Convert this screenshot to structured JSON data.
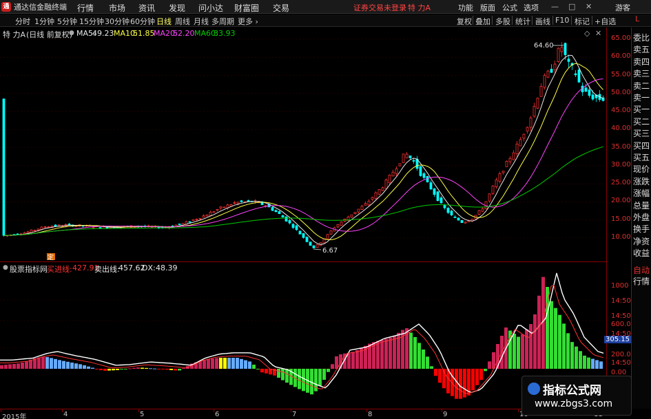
{
  "app": {
    "title": "通达信金融终端",
    "logo": "通"
  },
  "menu": {
    "items": [
      "行情",
      "市场",
      "资讯",
      "发现",
      "问小达",
      "财富圈",
      "交易"
    ],
    "login_status": "证券交易未登录",
    "stock_name": "特 力A",
    "right_items": [
      "功能",
      "版面",
      "公式",
      "选项"
    ],
    "guest": "游客",
    "window_buttons": [
      "—",
      "□",
      "✕"
    ]
  },
  "periods": [
    "分时",
    "1分钟",
    "5分钟",
    "15分钟",
    "30分钟",
    "60分钟",
    "日线",
    "周线",
    "月线",
    "多周期",
    "更多 ›"
  ],
  "active_period": "日线",
  "tools": [
    "复权",
    "叠加",
    "多股",
    "统计",
    "画线",
    "F10",
    "标记",
    "+自选"
  ],
  "corner_label": "L",
  "price_info": {
    "name": "特 力A",
    "mode": "(日线 前复权)",
    "ma5_label": "MA5:",
    "ma5": "49.23",
    "ma10_label": "MA10:",
    "ma10": "51.85",
    "ma20_label": "MA20:",
    "ma20": "52.20",
    "ma60_label": "MA60:",
    "ma60": "33.93",
    "high_marker": "64.60",
    "low_marker": "6.67",
    "ding_marker": "定"
  },
  "price_axis": [
    "65.00",
    "60.00",
    "55.00",
    "50.00",
    "45.00",
    "40.00",
    "35.00",
    "30.00",
    "25.00",
    "20.00",
    "15.00",
    "10.00"
  ],
  "right_panel": [
    "委比",
    "卖五",
    "卖四",
    "卖三",
    "卖二",
    "卖一",
    "买一",
    "买二",
    "买三",
    "买四",
    "买五",
    "现价",
    "涨跌",
    "涨幅",
    "总量",
    "外盘",
    "换手",
    "净资",
    "收益"
  ],
  "sub_right_panel": [
    "自动",
    "行情"
  ],
  "sub_info": {
    "indicator": "股票指标网",
    "buy_label": "买进线:",
    "buy_value": "427.91",
    "sell_label": "卖出线:",
    "sell_value": "457.62",
    "dx_label": "DX:",
    "dx_value": "48.39"
  },
  "sub_axis": [
    "1000",
    "14:50",
    "14:50",
    "600.0",
    "14:50",
    "305.15",
    "200.0",
    "14:50",
    "0.00"
  ],
  "dates": [
    "2015年",
    "4",
    "5",
    "6",
    "7",
    "8",
    "9",
    "10",
    "11"
  ],
  "watermark": {
    "title": "指标公式网",
    "url": "www.zbgs3.com"
  },
  "colors": {
    "up": "#ff3333",
    "down": "#00ffff",
    "ma5": "#e8e8e8",
    "ma10": "#ffff44",
    "ma20": "#ff44ff",
    "ma60": "#00cc00",
    "axis": "#e0302e",
    "bar_red": "#cc2255",
    "bar_blue": "#66aaff",
    "bar_green": "#33dd33",
    "bar_yellow": "#ffff00",
    "bar_darkred": "#ff0000"
  }
}
